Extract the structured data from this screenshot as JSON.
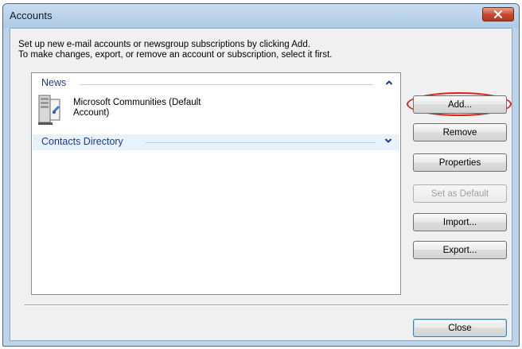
{
  "window": {
    "title": "Accounts"
  },
  "description": {
    "line1": "Set up new e-mail accounts or newsgroup subscriptions by clicking Add.",
    "line2": "To make changes, export, or remove an account or subscription, select it first."
  },
  "list": {
    "groups": [
      {
        "label": "News",
        "expanded": true
      },
      {
        "label": "Contacts Directory",
        "expanded": false
      }
    ],
    "accounts": [
      {
        "line1": "Microsoft Communities (Default",
        "line2": "Account)",
        "icon": "news-server-icon"
      }
    ]
  },
  "buttons": {
    "add": "Add...",
    "remove": "Remove",
    "properties": "Properties",
    "set_default": "Set as Default",
    "import": "Import...",
    "export": "Export...",
    "close": "Close"
  },
  "colors": {
    "highlight_ring": "#d9201a",
    "group_header_text": "#1e3b8a",
    "selected_group_bg": "#e7f2fb"
  }
}
